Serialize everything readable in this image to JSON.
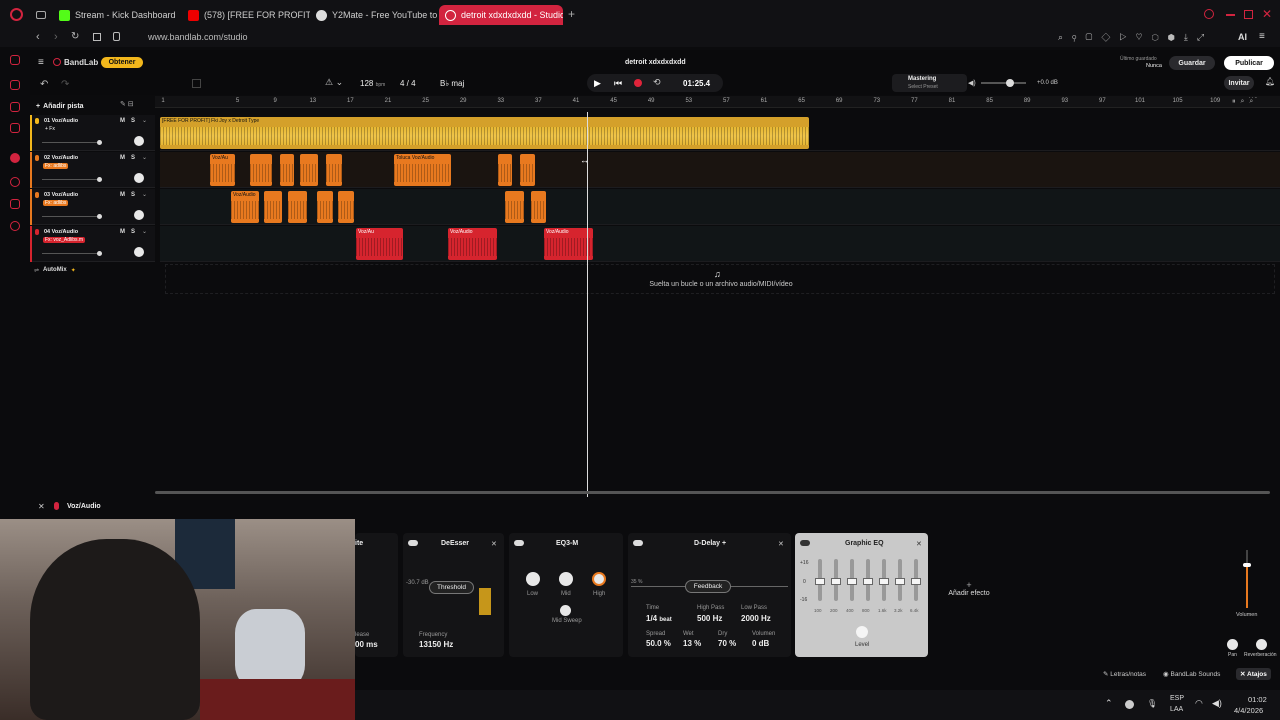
{
  "browser": {
    "tabs": [
      {
        "label": "Stream - Kick Dashboard",
        "icon": "kick-icon"
      },
      {
        "label": "(578) [FREE FOR PROFIT]",
        "icon": "youtube-icon"
      },
      {
        "label": "Y2Mate - Free YouTube to",
        "icon": "y2mate-icon"
      },
      {
        "label": "detroit xdxdxdxdd - Studio",
        "icon": "bandlab-icon"
      }
    ],
    "url": "www.bandlab.com/studio"
  },
  "header": {
    "logo": "BandLab",
    "obtener": "Obtener",
    "project_title": "detroit xdxdxdxdd",
    "bpm": "128",
    "bpm_unit": "bpm",
    "time_sig": "4 / 4",
    "key": "B♭ maj",
    "time": "01:25.4",
    "mastering_label": "Mastering",
    "mastering_preset": "Select Preset",
    "master_db": "+0.0 dB",
    "last_saved_label": "Último guardado",
    "last_saved_value": "Nunca",
    "save": "Guardar",
    "publish": "Publicar",
    "invite": "Invitar",
    "ai": "AI"
  },
  "add_track": "Añadir pista",
  "ruler": [
    "1",
    "5",
    "9",
    "13",
    "17",
    "21",
    "25",
    "29",
    "33",
    "37",
    "41",
    "45",
    "49",
    "53",
    "57",
    "61",
    "65",
    "69",
    "73",
    "77",
    "81",
    "85",
    "89",
    "93",
    "97",
    "101",
    "105",
    "109",
    "113"
  ],
  "tracks": [
    {
      "name": "01 Voz/Audio",
      "fx": "+ Fx"
    },
    {
      "name": "02 Voz/Audio",
      "fx": "Fx: adlibs"
    },
    {
      "name": "03 Voz/Audio",
      "fx": "Fx: adlibs"
    },
    {
      "name": "04 Voz/Audio",
      "fx": "Fx: voz_Adlibs.m"
    }
  ],
  "clips": {
    "t1": "[FREE FOR PROFIT] Fki Joy x Detroit Type",
    "t2_a": "Voz/Au",
    "t2_b": "Toluca",
    "t2_c": "Voz/Audio",
    "t3_a": "Voz/Audio",
    "t4_a": "Voz/Au",
    "t4_b": "Voz/Audio",
    "t4_c": "Voz/Audio"
  },
  "automix": "AutoMix",
  "drop_hint": "Suelta un bucle o un archivo audio/MIDI/vídeo",
  "fx_panel": {
    "track_label": "Voz/Audio",
    "partial": {
      "title": "ite",
      "label": "lease",
      "value": "00 ms"
    },
    "deesser": {
      "title": "DeEsser",
      "db": "-30.7 dB",
      "threshold": "Threshold",
      "freq_label": "Frequency",
      "freq": "13150 Hz"
    },
    "eq3": {
      "title": "EQ3-M",
      "low": "Low",
      "mid": "Mid",
      "high": "High",
      "sweep": "Mid Sweep"
    },
    "delay": {
      "title": "D-Delay +",
      "pct": "35 %",
      "feedback": "Feedback",
      "time_label": "Time",
      "time": "1/4",
      "time_unit": "beat",
      "hp_label": "High Pass",
      "hp": "500 Hz",
      "lp_label": "Low Pass",
      "lp": "2000 Hz",
      "spread_label": "Spread",
      "spread": "50.0 %",
      "wet_label": "Wet",
      "wet": "13 %",
      "dry_label": "Dry",
      "dry": "70 %",
      "vol_label": "Volumen",
      "vol": "0 dB"
    },
    "geq": {
      "title": "Graphic EQ",
      "plus": "+16",
      "zero": "0",
      "minus": "-16",
      "bands": [
        "100",
        "200",
        "400",
        "800",
        "1.6k",
        "3.2k",
        "6.4k"
      ],
      "level": "Level"
    },
    "add_effect": "Añadir efecto",
    "volumen": "Volumen",
    "pan": "Pan",
    "reverb": "Reverberación"
  },
  "footer": {
    "lyrics": "Letras/notas",
    "sounds": "BandLab Sounds",
    "shortcuts": "Atajos"
  },
  "taskbar": {
    "lang1": "ESP",
    "lang2": "LAA",
    "time": "01:02",
    "date": "4/4/2026"
  }
}
